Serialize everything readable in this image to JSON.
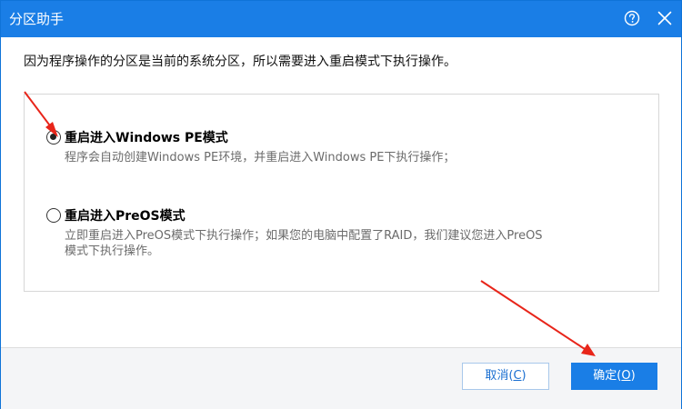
{
  "window": {
    "title": "分区助手",
    "help_icon": "help-circle-icon",
    "close_icon": "close-icon",
    "title_bar_color": "#1a7ee6"
  },
  "message": "因为程序操作的分区是当前的系统分区，所以需要进入重启模式下执行操作。",
  "options": [
    {
      "label": "重启进入Windows PE模式",
      "description": "程序会自动创建Windows PE环境，并重启进入Windows PE下执行操作；",
      "selected": true
    },
    {
      "label": "重启进入PreOS模式",
      "description_line1": "立即重启进入PreOS模式下执行操作；如果您的电脑中配置了RAID，我们建议您进入PreOS",
      "description_line2": "模式下执行操作。",
      "selected": false
    }
  ],
  "buttons": {
    "cancel_prefix": "取消(",
    "cancel_accel": "C",
    "cancel_suffix": ")",
    "ok_prefix": "确定(",
    "ok_accel": "O",
    "ok_suffix": ")"
  },
  "annotation_color": "#e8251a"
}
